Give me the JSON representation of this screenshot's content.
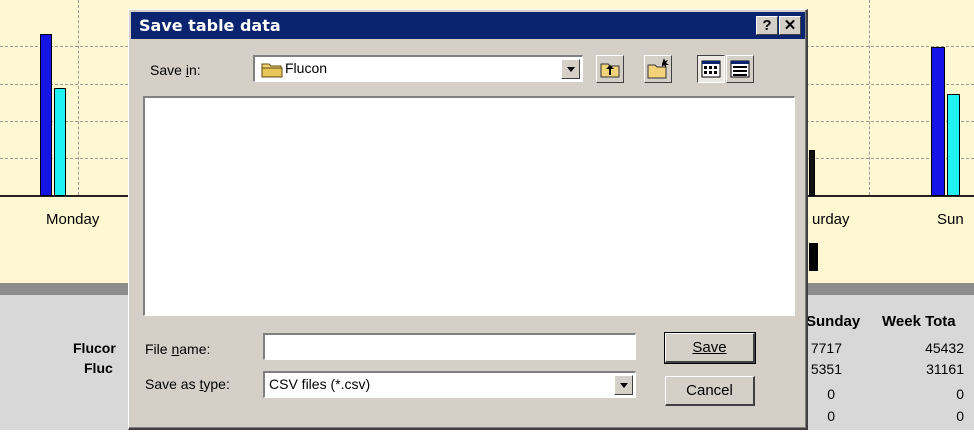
{
  "background": {
    "chart": {
      "day_labels": [
        "Monday",
        "urday",
        "Sun"
      ]
    },
    "table": {
      "headers": [
        "Sunday",
        "Week Tota"
      ],
      "row_labels": [
        "Flucor",
        "Fluc"
      ],
      "rows": [
        [
          "7717",
          "45432"
        ],
        [
          "5351",
          "31161"
        ],
        [
          "0",
          "0"
        ],
        [
          "0",
          "0"
        ]
      ]
    }
  },
  "dialog": {
    "title": "Save table data",
    "help_glyph": "?",
    "close_glyph": "✕",
    "save_in_label": "Save in:",
    "save_in_value": "Flucon",
    "file_name_label": "File name:",
    "file_name_value": "",
    "save_as_type_label": "Save as type:",
    "save_as_type_value": "CSV files (*.csv)",
    "save_button": "Save",
    "cancel_button": "Cancel",
    "icons": [
      "folder-icon",
      "up-one-level-icon",
      "new-folder-icon",
      "list-view-icon",
      "details-view-icon"
    ]
  }
}
